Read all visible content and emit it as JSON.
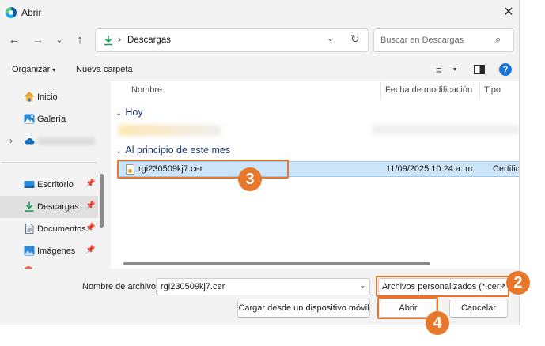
{
  "window": {
    "title": "Abrir",
    "close_glyph": "✕"
  },
  "nav": {
    "back": "←",
    "forward": "→",
    "recent": "⌄",
    "up": "↑",
    "address_path": "Descargas",
    "address_sep": "›",
    "address_drop": "⌄",
    "refresh": "↻",
    "search_placeholder": "Buscar en Descargas",
    "search_icon": "⌕"
  },
  "toolbar": {
    "organize": "Organizar",
    "organize_caret": "▾",
    "new_folder": "Nueva carpeta",
    "view_icon": "≡",
    "view_caret": "▾",
    "help": "?"
  },
  "sidebar": {
    "items": [
      {
        "label": "Inicio",
        "icon": "home-icon"
      },
      {
        "label": "Galería",
        "icon": "gallery-icon"
      },
      {
        "label": "",
        "icon": "cloud-icon",
        "chevron": "›"
      },
      {
        "label": "Escritorio",
        "icon": "desktop-icon",
        "pin": "📌"
      },
      {
        "label": "Descargas",
        "icon": "download-icon",
        "pin": "📌"
      },
      {
        "label": "Documentos",
        "icon": "documents-icon",
        "pin": "📌"
      },
      {
        "label": "Imágenes",
        "icon": "images-icon",
        "pin": "📌"
      }
    ]
  },
  "columns": {
    "name": "Nombre",
    "date": "Fecha de modificación",
    "type": "Tipo",
    "sort_caret": "⌃"
  },
  "groups": [
    {
      "label": "Hoy",
      "chevron": "⌄"
    },
    {
      "label": "Al principio de este mes",
      "chevron": "⌄"
    }
  ],
  "files": [
    {
      "name": "rgi230509kj7.cer",
      "date": "11/09/2025 10:24 a. m.",
      "type": "Certificad"
    }
  ],
  "bottom": {
    "filename_label": "Nombre de archivo:",
    "filename_value": "rgi230509kj7.cer",
    "filename_drop": "⌄",
    "filter_value": "Archivos personalizados (*.cer;*",
    "filter_drop": "⌄",
    "mobile_button": "Cargar desde un dispositivo móvil",
    "open_button": "Abrir",
    "cancel_button": "Cancelar"
  },
  "annotations": {
    "step_file": "3",
    "step_filter": "2",
    "step_open": "4",
    "accent_color": "#e8772e"
  }
}
